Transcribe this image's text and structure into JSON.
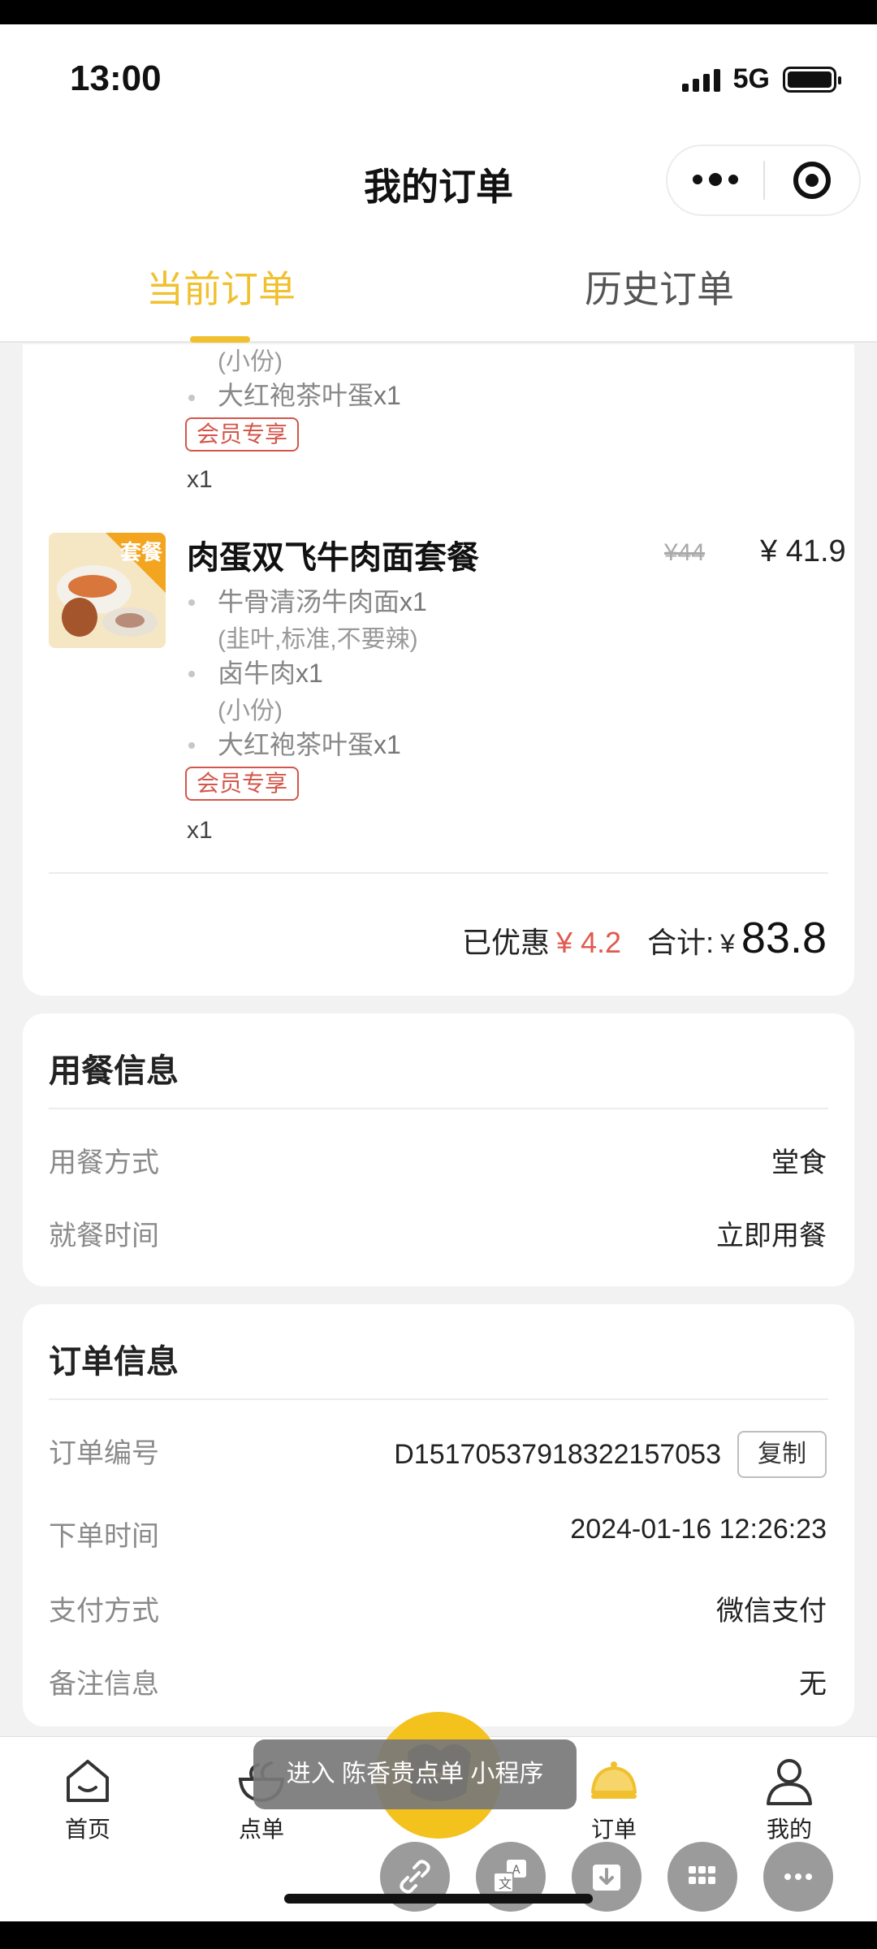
{
  "status_bar": {
    "time": "13:00",
    "network": "5G"
  },
  "header": {
    "title": "我的订单"
  },
  "tabs": {
    "current": "当前订单",
    "history": "历史订单"
  },
  "order": {
    "prev_item": {
      "option": "(小份)",
      "egg": "大红袍茶叶蛋",
      "egg_qty": "x1",
      "tag": "会员专享",
      "qty": "x1"
    },
    "item": {
      "name": "肉蛋双飞牛肉面套餐",
      "thumb_badge": "套餐",
      "old_price": "¥44",
      "price": "¥ 41.9",
      "subs": [
        {
          "name": "牛骨清汤牛肉面",
          "qty": "x1",
          "option": "(韭叶,标准,不要辣)"
        },
        {
          "name": "卤牛肉",
          "qty": "x1",
          "option": "(小份)"
        },
        {
          "name": "大红袍茶叶蛋",
          "qty": "x1",
          "option": ""
        }
      ],
      "tag": "会员专享",
      "qty": "x1"
    },
    "summary": {
      "discount_label": "已优惠",
      "discount": "¥ 4.2",
      "total_label": "合计:",
      "currency": "¥",
      "total": "83.8"
    }
  },
  "dining": {
    "title": "用餐信息",
    "rows": [
      {
        "label": "用餐方式",
        "value": "堂食"
      },
      {
        "label": "就餐时间",
        "value": "立即用餐"
      }
    ]
  },
  "order_info": {
    "title": "订单信息",
    "number_label": "订单编号",
    "number": "D15170537918322157053",
    "copy_label": "复制",
    "time_label": "下单时间",
    "time": "2024-01-16 12:26:23",
    "pay_label": "支付方式",
    "pay": "微信支付",
    "note_label": "备注信息",
    "note": "无"
  },
  "tabbar": {
    "home": "首页",
    "menu": "点单",
    "orders": "订单",
    "mine": "我的",
    "toast": "进入 陈香贵点单 小程序"
  },
  "colors": {
    "accent": "#f0c02e",
    "discount": "#e05a4f",
    "tag": "#d4564a"
  }
}
